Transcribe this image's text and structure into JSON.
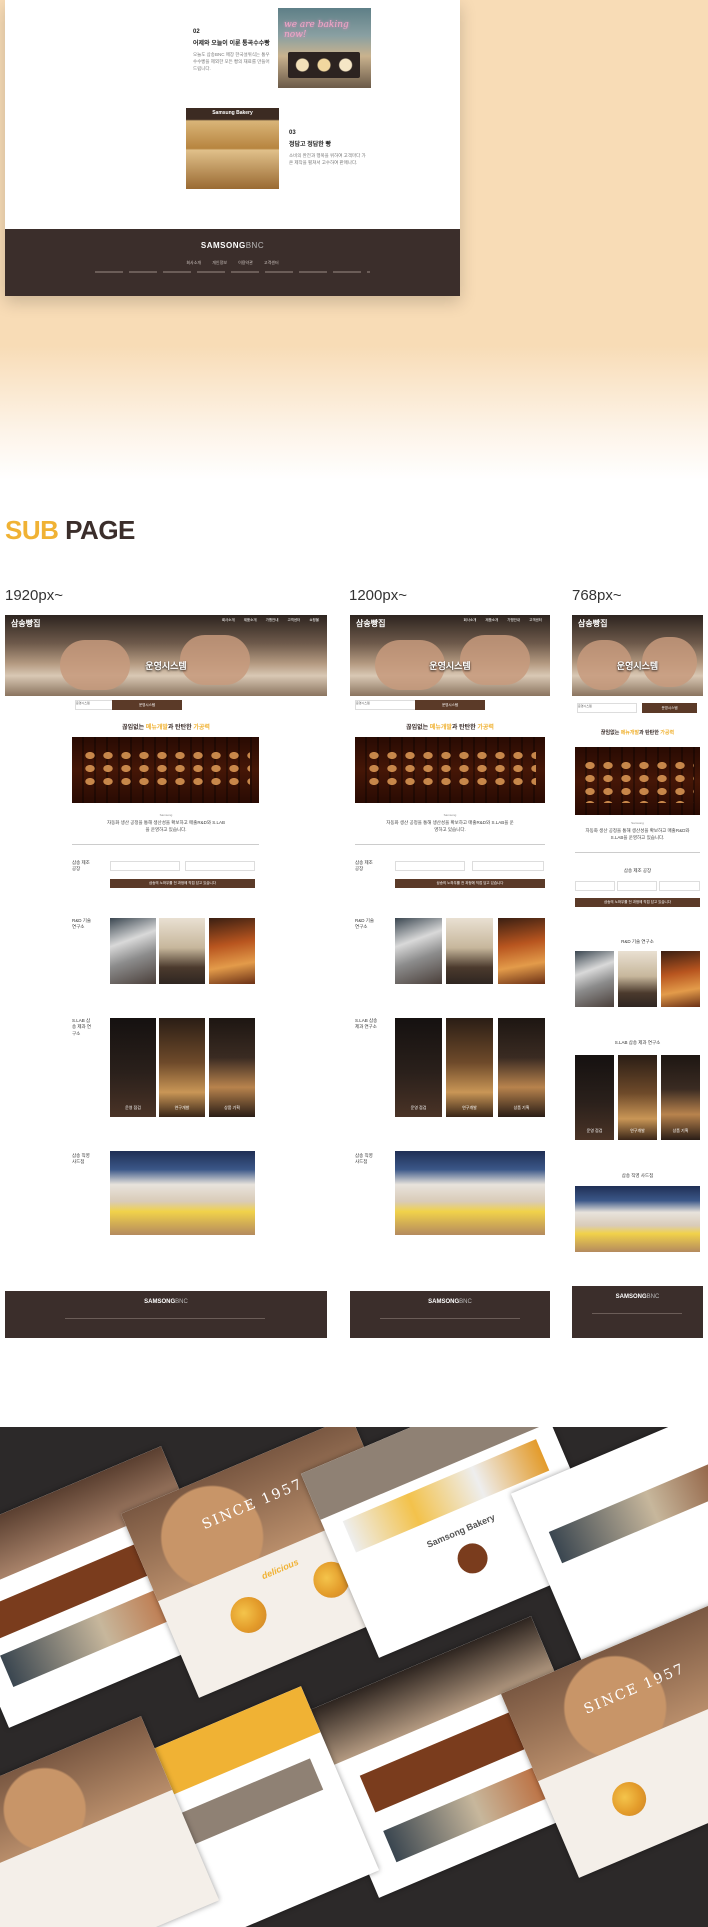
{
  "mockup": {
    "section2": {
      "num": "02",
      "title": "어제와 오늘이 이룬 통곡수수빵",
      "desc": "오늘도 삼송BNC 매장 한국설위식는 통우수수빵을 제외한 모든 빵의 재료를 만들어 드립니다."
    },
    "section3": {
      "num": "03",
      "title": "정답고 정답한 빵",
      "desc": "소비의 완전과 행복을 위하여 고객마다 가온 제작을 펼쳐서 고수하여 판매나다."
    },
    "neon_text": "we are baking now!",
    "case_sign": "Samsung Bakery",
    "footer": {
      "logo_main": "SAMSONG",
      "logo_sub": "BNC",
      "links": [
        "회사소개",
        "개인정보",
        "이용약관",
        "고객센터"
      ]
    }
  },
  "sub": {
    "title_accent": "SUB",
    "title_rest": " PAGE",
    "breakpoints": [
      "1920px~",
      "1200px~",
      "768px~"
    ]
  },
  "subpage": {
    "hero_caption": "운영시스템",
    "logo": "삼송빵집",
    "nav": [
      "회사소개",
      "제품소개",
      "가맹안내",
      "고객센터",
      "쇼핑몰"
    ],
    "subnav_label": "운영시스템",
    "subnav_button": "운영시스템",
    "tagline_pre": "끊임없는 ",
    "tagline_y1": "메뉴개발",
    "tagline_mid": "과 탄탄한 ",
    "tagline_y2": "가공력",
    "small_caption": "Samsong",
    "desc": "자동화 생산 공정을 통해 생산성을 확보하고 매출R&D와 S.LAB을 운영하고 있습니다.",
    "sec_factory": "삼송 제조 공장",
    "sec_rd": "R&D 기술 연구소",
    "sec_slab": "S.LAB 삼송 제과 연구소",
    "sec_store": "삼송 직영 사드점",
    "lab_caps": [
      "운영 점검",
      "연구개발",
      "상품 기획"
    ],
    "bar_text": "삼송의 노하우를 전 과정에 직접 담고 있습니다",
    "footer_logo_main": "SAMSONG",
    "footer_logo_sub": "BNC"
  },
  "collage": {
    "since": "SINCE 1957",
    "delicious": "delicious",
    "brand": "Samsong Bakery"
  }
}
